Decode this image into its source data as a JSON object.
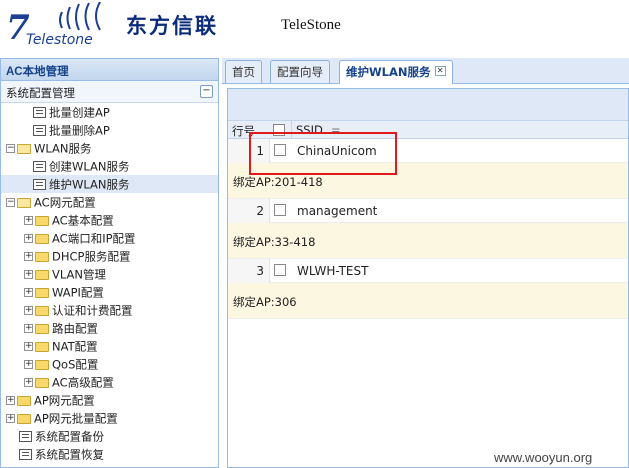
{
  "header": {
    "logo_text": "Telestone",
    "brand_cn": "东方信联",
    "brand_en": "TeleStone"
  },
  "sidebar": {
    "title": "AC本地管理",
    "section": "系统配置管理",
    "collapse_symbol": "−",
    "items": [
      {
        "label": "批量创建AP",
        "level": 1,
        "type": "leaf"
      },
      {
        "label": "批量删除AP",
        "level": 1,
        "type": "leaf"
      },
      {
        "label": "WLAN服务",
        "level": 0,
        "type": "folder-open"
      },
      {
        "label": "创建WLAN服务",
        "level": 1,
        "type": "leaf"
      },
      {
        "label": "维护WLAN服务",
        "level": 1,
        "type": "leaf",
        "selected": true
      },
      {
        "label": "AC网元配置",
        "level": 0,
        "type": "folder-open"
      },
      {
        "label": "AC基本配置",
        "level": 1,
        "type": "folder"
      },
      {
        "label": "AC端口和IP配置",
        "level": 1,
        "type": "folder"
      },
      {
        "label": "DHCP服务配置",
        "level": 1,
        "type": "folder"
      },
      {
        "label": "VLAN管理",
        "level": 1,
        "type": "folder"
      },
      {
        "label": "WAPI配置",
        "level": 1,
        "type": "folder"
      },
      {
        "label": "认证和计费配置",
        "level": 1,
        "type": "folder"
      },
      {
        "label": "路由配置",
        "level": 1,
        "type": "folder"
      },
      {
        "label": "NAT配置",
        "level": 1,
        "type": "folder"
      },
      {
        "label": "QoS配置",
        "level": 1,
        "type": "folder"
      },
      {
        "label": "AC高级配置",
        "level": 1,
        "type": "folder"
      },
      {
        "label": "AP网元配置",
        "level": 0,
        "type": "folder"
      },
      {
        "label": "AP网元批量配置",
        "level": 0,
        "type": "folder"
      },
      {
        "label": "系统配置备份",
        "level": 0,
        "type": "leaf"
      },
      {
        "label": "系统配置恢复",
        "level": 0,
        "type": "leaf"
      }
    ]
  },
  "tabs": [
    {
      "label": "首页",
      "active": false
    },
    {
      "label": "配置向导",
      "active": false
    },
    {
      "label": "维护WLAN服务",
      "active": true,
      "close": "✕"
    }
  ],
  "grid": {
    "row_header": "行号",
    "column": "SSID",
    "sort_symbol": "=",
    "rows": [
      {
        "num": "1",
        "ssid": "ChinaUnicom",
        "detail": "绑定AP:201-418"
      },
      {
        "num": "2",
        "ssid": "management",
        "detail": "绑定AP:33-418"
      },
      {
        "num": "3",
        "ssid": "WLWH-TEST",
        "detail": "绑定AP:306"
      }
    ]
  },
  "watermark": "www.wooyun.org",
  "colors": {
    "brand_blue": "#1b3f93",
    "panel_border": "#99bbe8",
    "highlight_red": "#e01a1a",
    "detail_bg": "#fcf7e1"
  }
}
